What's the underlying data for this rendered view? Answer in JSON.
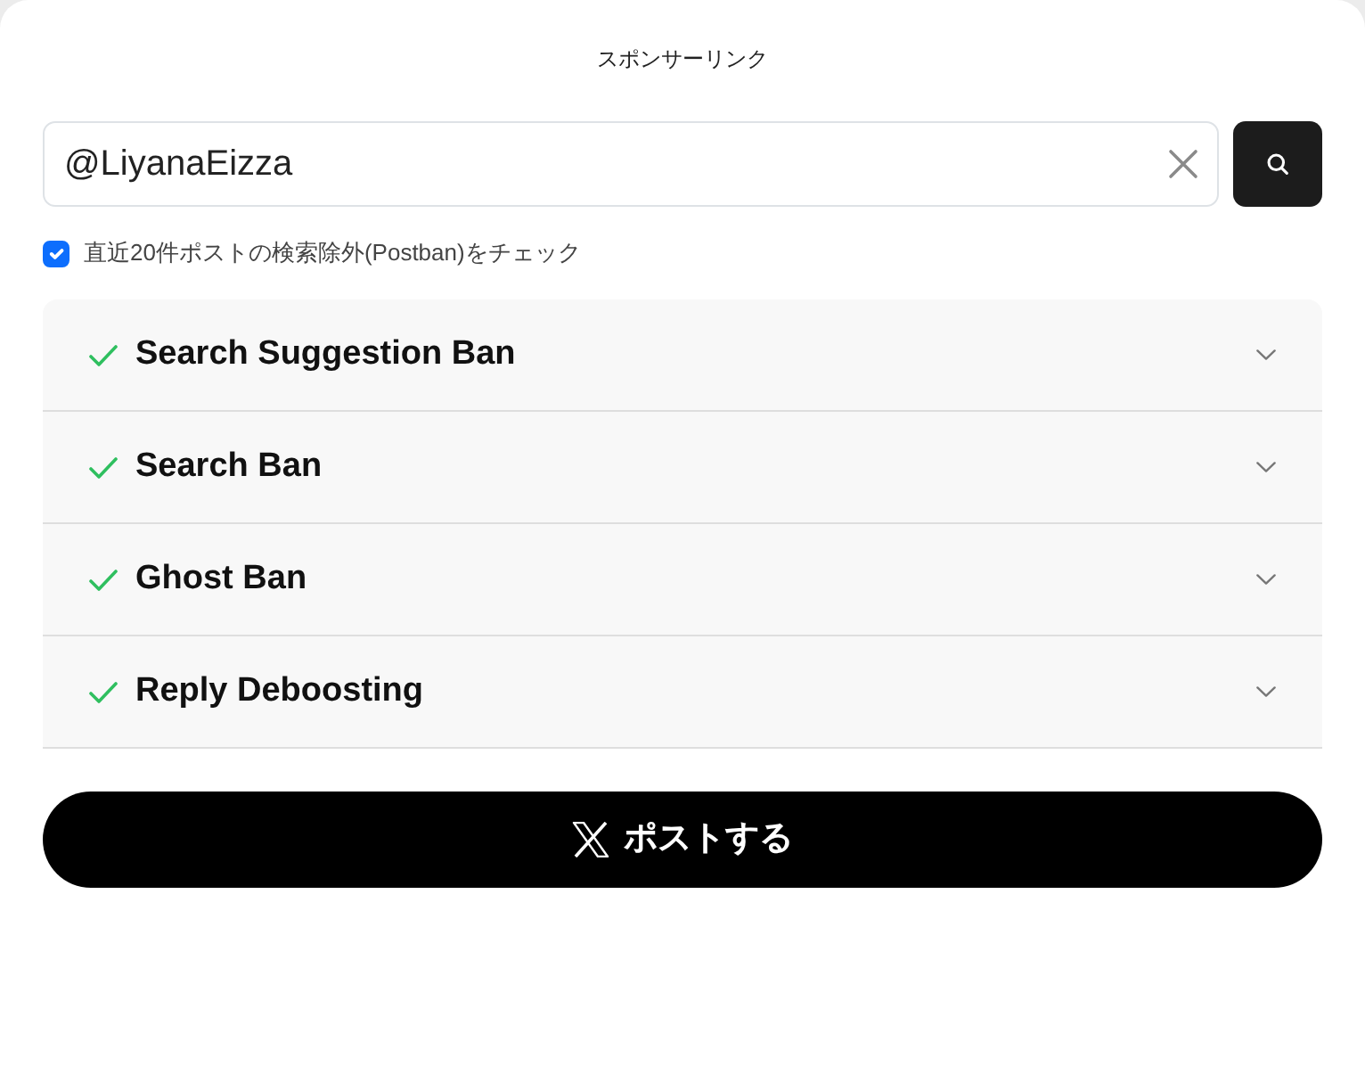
{
  "sponsor_label": "スポンサーリンク",
  "search": {
    "value": "@LiyanaEizza"
  },
  "postban_option": {
    "label": "直近20件ポストの検索除外(Postban)をチェック",
    "checked": true
  },
  "checks": [
    {
      "title": "Search Suggestion Ban",
      "passed": true,
      "expanded": false
    },
    {
      "title": "Search Ban",
      "passed": true,
      "expanded": false
    },
    {
      "title": "Ghost Ban",
      "passed": true,
      "expanded": false
    },
    {
      "title": "Reply Deboosting",
      "passed": true,
      "expanded": false
    }
  ],
  "post_button": {
    "label": "ポストする"
  }
}
